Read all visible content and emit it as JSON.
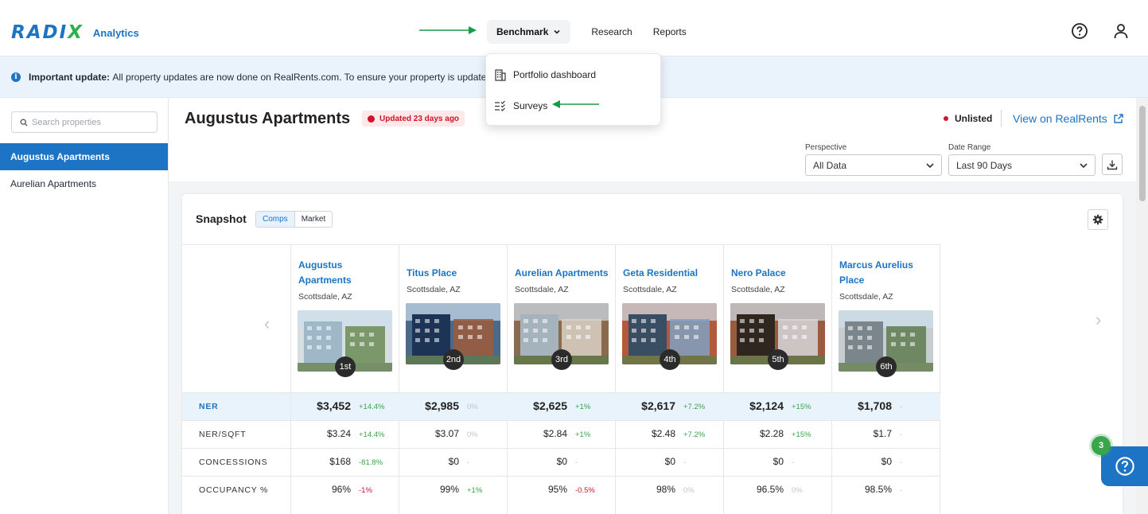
{
  "brand": {
    "logo_text": "RADIX",
    "product": "Analytics"
  },
  "nav": {
    "items": [
      {
        "label": "Benchmark"
      },
      {
        "label": "Research"
      },
      {
        "label": "Reports"
      }
    ]
  },
  "banner": {
    "bold": "Important update:",
    "text": "All property updates are now done on RealRents.com. To ensure your property is updated"
  },
  "menu": {
    "items": [
      {
        "label": "Portfolio dashboard",
        "icon": "building-icon"
      },
      {
        "label": "Surveys",
        "icon": "checklist-icon"
      }
    ]
  },
  "sidebar": {
    "search_placeholder": "Search properties",
    "items": [
      {
        "label": "Augustus Apartments",
        "active": true
      },
      {
        "label": "Aurelian Apartments",
        "active": false
      }
    ]
  },
  "property": {
    "title": "Augustus Apartments",
    "updated": "Updated 23 days ago",
    "status": "Unlisted",
    "view_link": "View on RealRents"
  },
  "filters": {
    "perspective_label": "Perspective",
    "perspective_value": "All Data",
    "date_label": "Date Range",
    "date_value": "Last 90 Days"
  },
  "snapshot": {
    "title": "Snapshot",
    "toggle": [
      "Comps",
      "Market"
    ],
    "comps": [
      {
        "name": "Augustus Apartments",
        "city": "Scottsdale, AZ",
        "rank": "1st",
        "two_line": true
      },
      {
        "name": "Titus Place",
        "city": "Scottsdale, AZ",
        "rank": "2nd",
        "two_line": false
      },
      {
        "name": "Aurelian Apartments",
        "city": "Scottsdale, AZ",
        "rank": "3rd",
        "two_line": false
      },
      {
        "name": "Geta Residential",
        "city": "Scottsdale, AZ",
        "rank": "4th",
        "two_line": false
      },
      {
        "name": "Nero Palace",
        "city": "Scottsdale, AZ",
        "rank": "5th",
        "two_line": false
      },
      {
        "name": "Marcus Aurelius Place",
        "city": "Scottsdale, AZ",
        "rank": "6th",
        "two_line": true
      }
    ],
    "rows": [
      {
        "label": "NER",
        "cells": [
          {
            "v": "$3,452",
            "p": "+14.4%",
            "t": "pos"
          },
          {
            "v": "$2,985",
            "p": "0%",
            "t": "neu"
          },
          {
            "v": "$2,625",
            "p": "+1%",
            "t": "pos"
          },
          {
            "v": "$2,617",
            "p": "+7.2%",
            "t": "pos"
          },
          {
            "v": "$2,124",
            "p": "+15%",
            "t": "pos"
          },
          {
            "v": "$1,708",
            "p": "-",
            "t": "neu"
          }
        ]
      },
      {
        "label": "NER/SQFT",
        "cells": [
          {
            "v": "$3.24",
            "p": "+14.4%",
            "t": "pos"
          },
          {
            "v": "$3.07",
            "p": "0%",
            "t": "neu"
          },
          {
            "v": "$2.84",
            "p": "+1%",
            "t": "pos"
          },
          {
            "v": "$2.48",
            "p": "+7.2%",
            "t": "pos"
          },
          {
            "v": "$2.28",
            "p": "+15%",
            "t": "pos"
          },
          {
            "v": "$1.7",
            "p": "-",
            "t": "neu"
          }
        ]
      },
      {
        "label": "CONCESSIONS",
        "cells": [
          {
            "v": "$168",
            "p": "-81.8%",
            "t": "pos"
          },
          {
            "v": "$0",
            "p": "-",
            "t": "neu"
          },
          {
            "v": "$0",
            "p": "-",
            "t": "neu"
          },
          {
            "v": "$0",
            "p": "-",
            "t": "neu"
          },
          {
            "v": "$0",
            "p": "-",
            "t": "neu"
          },
          {
            "v": "$0",
            "p": "-",
            "t": "neu"
          }
        ]
      },
      {
        "label": "OCCUPANCY %",
        "cells": [
          {
            "v": "96%",
            "p": "-1%",
            "t": "neg"
          },
          {
            "v": "99%",
            "p": "+1%",
            "t": "pos"
          },
          {
            "v": "95%",
            "p": "-0.5%",
            "t": "neg"
          },
          {
            "v": "98%",
            "p": "0%",
            "t": "neu"
          },
          {
            "v": "96.5%",
            "p": "0%",
            "t": "neu"
          },
          {
            "v": "98.5%",
            "p": "-",
            "t": "neu"
          }
        ]
      }
    ]
  },
  "help": {
    "badge_count": "3"
  },
  "colors": {
    "accent": "#1d74c4",
    "positive": "#3aa54a",
    "negative": "#d0142c",
    "arrow": "#1a9b49"
  }
}
